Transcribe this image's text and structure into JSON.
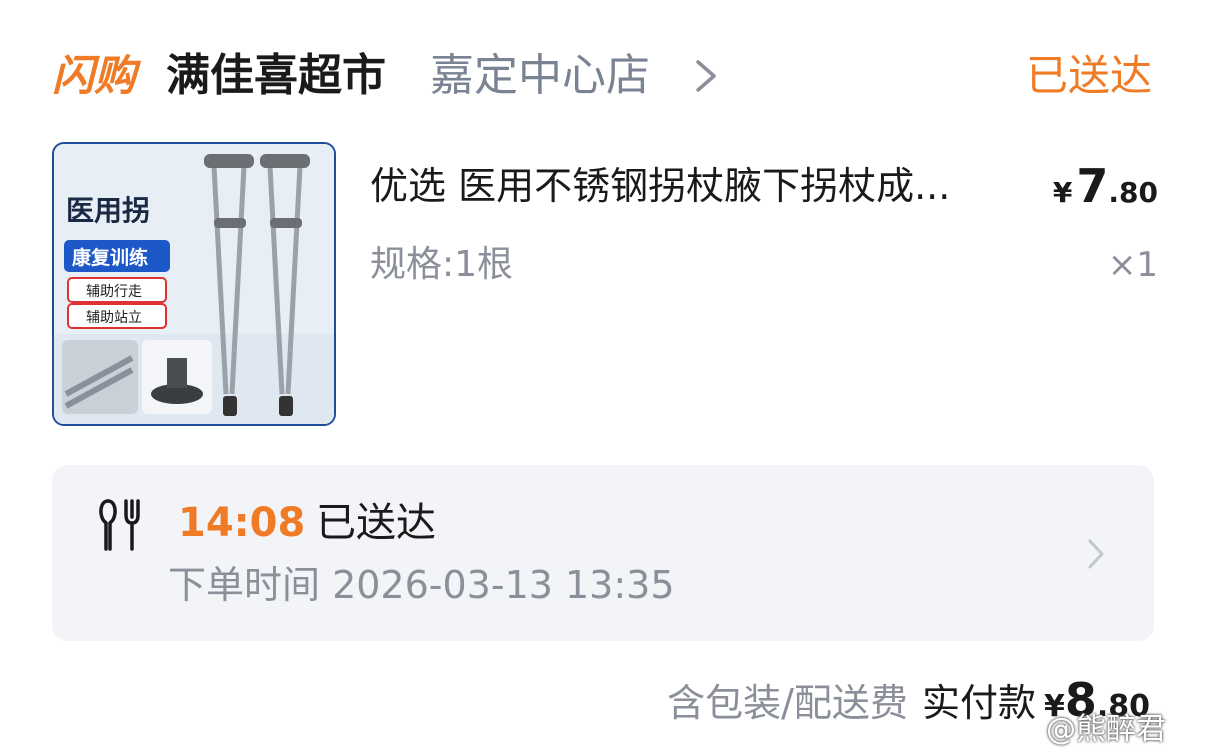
{
  "header": {
    "logo_text": "闪购",
    "store_name": "满佳喜超市",
    "branch": "嘉定中心店",
    "status": "已送达"
  },
  "item": {
    "image_badge": "医用拐",
    "image_tag1": "康复训练",
    "image_tag2": "辅助行走",
    "image_tag3": "辅助站立",
    "title": "优选  医用不锈钢拐杖腋下拐杖成...",
    "price_symbol": "¥",
    "price_int": "7",
    "price_dec": ".80",
    "spec": "规格:1根",
    "qty": "×1"
  },
  "delivery": {
    "time": "14:08",
    "status": "已送达",
    "order_time": "下单时间 2026-03-13 13:35"
  },
  "footer": {
    "fee_note": "含包装/配送费",
    "paid_label": "实付款",
    "paid_symbol": "¥",
    "paid_int": "8",
    "paid_dec": ".80"
  },
  "watermark": "@熊醉君",
  "colors": {
    "accent": "#f07b26",
    "muted": "#8a8f99",
    "card_bg": "#f2f4f8"
  }
}
